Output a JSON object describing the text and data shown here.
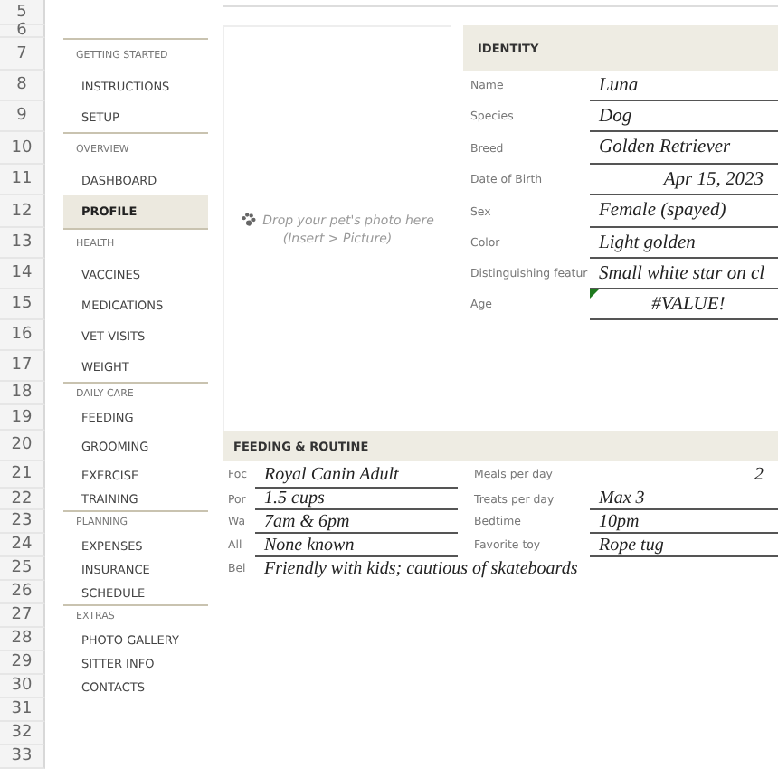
{
  "row_numbers": [
    "5",
    "6",
    "7",
    "8",
    "9",
    "10",
    "11",
    "12",
    "13",
    "14",
    "15",
    "16",
    "17",
    "18",
    "19",
    "20",
    "21",
    "22",
    "23",
    "24",
    "25",
    "26",
    "27",
    "28",
    "29",
    "30",
    "31",
    "32",
    "33"
  ],
  "nav": [
    {
      "section": "GETTING STARTED",
      "items": [
        {
          "label": "INSTRUCTIONS",
          "selected": false
        },
        {
          "label": "SETUP",
          "selected": false
        }
      ]
    },
    {
      "section": "OVERVIEW",
      "items": [
        {
          "label": "DASHBOARD",
          "selected": false
        },
        {
          "label": "PROFILE",
          "selected": true
        }
      ]
    },
    {
      "section": "HEALTH",
      "items": [
        {
          "label": "VACCINES",
          "selected": false
        },
        {
          "label": "MEDICATIONS",
          "selected": false
        },
        {
          "label": "VET VISITS",
          "selected": false
        },
        {
          "label": "WEIGHT",
          "selected": false
        }
      ]
    },
    {
      "section": "DAILY CARE",
      "items": [
        {
          "label": "FEEDING",
          "selected": false
        },
        {
          "label": "GROOMING",
          "selected": false
        },
        {
          "label": "EXERCISE",
          "selected": false
        },
        {
          "label": "TRAINING",
          "selected": false
        }
      ]
    },
    {
      "section": "PLANNING",
      "items": [
        {
          "label": "EXPENSES",
          "selected": false
        },
        {
          "label": "INSURANCE",
          "selected": false
        },
        {
          "label": "SCHEDULE",
          "selected": false
        }
      ]
    },
    {
      "section": "EXTRAS",
      "items": [
        {
          "label": "PHOTO GALLERY",
          "selected": false
        },
        {
          "label": "SITTER INFO",
          "selected": false
        },
        {
          "label": "CONTACTS",
          "selected": false
        }
      ]
    }
  ],
  "photo": {
    "line1": "Drop your pet's photo here",
    "line2": "(Insert > Picture)"
  },
  "identity": {
    "title": "IDENTITY",
    "fields": [
      {
        "label": "Name",
        "value": "Luna",
        "kind": "text"
      },
      {
        "label": "Species",
        "value": "Dog",
        "kind": "text"
      },
      {
        "label": "Breed",
        "value": "Golden Retriever",
        "kind": "text"
      },
      {
        "label": "Date of Birth",
        "value": "Apr 15, 2023",
        "kind": "date"
      },
      {
        "label": "Sex",
        "value": "Female (spayed)",
        "kind": "text"
      },
      {
        "label": "Color",
        "value": "Light golden",
        "kind": "text"
      },
      {
        "label": "Distinguishing featur",
        "value": "Small white star on cl",
        "kind": "text"
      },
      {
        "label": "Age",
        "value": "#VALUE!",
        "kind": "error"
      }
    ]
  },
  "feeding": {
    "title": "FEEDING & ROUTINE",
    "left": [
      {
        "label": "Foc",
        "value": "Royal Canin Adult"
      },
      {
        "label": "Por",
        "value": "1.5 cups"
      },
      {
        "label": "Wa",
        "value": "7am & 6pm"
      },
      {
        "label": "All",
        "value": "None known"
      },
      {
        "label": "Bel",
        "value": "Friendly with kids; cautious of skateboards"
      }
    ],
    "right": [
      {
        "label": "Meals per day",
        "value": "2",
        "kind": "number"
      },
      {
        "label": "Treats per day",
        "value": "Max 3",
        "kind": "text"
      },
      {
        "label": "Bedtime",
        "value": "10pm",
        "kind": "text"
      },
      {
        "label": "Favorite toy",
        "value": "Rope tug",
        "kind": "text"
      }
    ]
  }
}
